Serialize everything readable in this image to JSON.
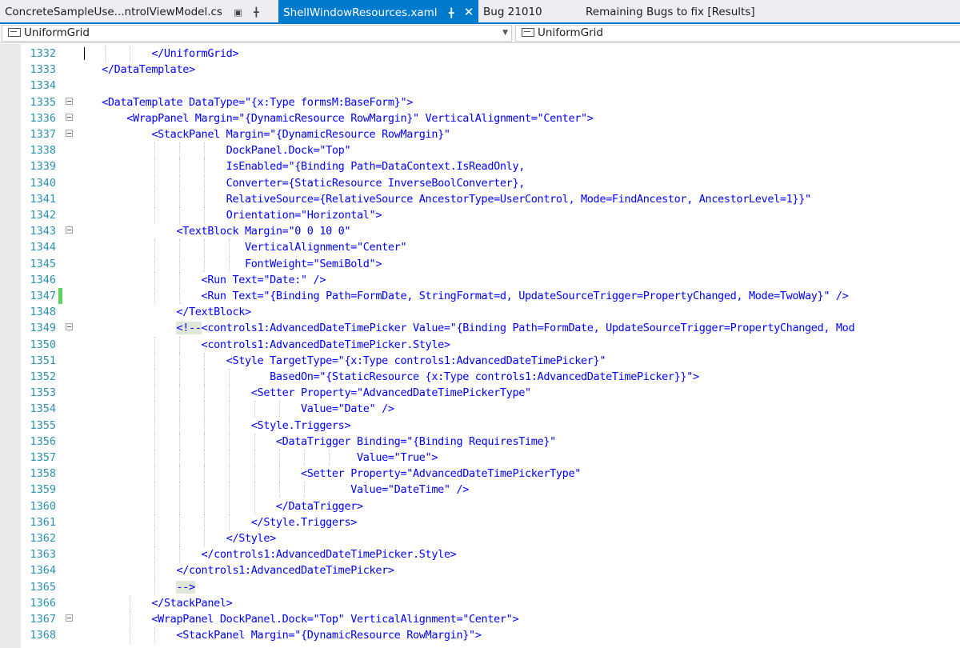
{
  "tabs": [
    {
      "label": "ConcreteSampleUse...ntrolViewModel.cs",
      "pin": "🖹",
      "pin_glyph": "⊞",
      "active": false
    },
    {
      "label": "ShellWindowResources.xaml",
      "active": true
    },
    {
      "label": "Bug 21010",
      "active": false
    },
    {
      "label": "Remaining Bugs to fix [Results]",
      "active": false
    }
  ],
  "navbar": {
    "left_value": "UniformGrid",
    "right_value": "UniformGrid"
  },
  "icons": {
    "lock": "lock-icon",
    "pin": "pin-icon",
    "close": "close-icon",
    "combo": "class-icon",
    "dropdown": "chevron-down-icon"
  },
  "colors": {
    "accent": "#007acc",
    "line_numbers": "#2b91af",
    "xml_markup": "#0000ff",
    "change_bar": "#5fd35f"
  },
  "editor": {
    "lines": [
      {
        "num": "1332",
        "text": "            </UniformGrid>"
      },
      {
        "num": "1333",
        "text": "    </DataTemplate>"
      },
      {
        "num": "1334",
        "text": ""
      },
      {
        "num": "1335",
        "text": "    <DataTemplate DataType=\"{x:Type formsM:BaseForm}\">"
      },
      {
        "num": "1336",
        "text": "        <WrapPanel Margin=\"{DynamicResource RowMargin}\" VerticalAlignment=\"Center\">"
      },
      {
        "num": "1337",
        "text": "            <StackPanel Margin=\"{DynamicResource RowMargin}\""
      },
      {
        "num": "1338",
        "text": "                        DockPanel.Dock=\"Top\""
      },
      {
        "num": "1339",
        "text": "                        IsEnabled=\"{Binding Path=DataContext.IsReadOnly,"
      },
      {
        "num": "1340",
        "text": "                        Converter={StaticResource InverseBoolConverter},"
      },
      {
        "num": "1341",
        "text": "                        RelativeSource={RelativeSource AncestorType=UserControl, Mode=FindAncestor, AncestorLevel=1}}\""
      },
      {
        "num": "1342",
        "text": "                        Orientation=\"Horizontal\">"
      },
      {
        "num": "1343",
        "text": "                <TextBlock Margin=\"0 0 10 0\""
      },
      {
        "num": "1344",
        "text": "                           VerticalAlignment=\"Center\""
      },
      {
        "num": "1345",
        "text": "                           FontWeight=\"SemiBold\">"
      },
      {
        "num": "1346",
        "text": "                    <Run Text=\"Date:\" />"
      },
      {
        "num": "1347",
        "text": "                    <Run Text=\"{Binding Path=FormDate, StringFormat=d, UpdateSourceTrigger=PropertyChanged, Mode=TwoWay}\" />"
      },
      {
        "num": "1348",
        "text": "                </TextBlock>"
      },
      {
        "num": "1349",
        "text": "                <!--<controls1:AdvancedDateTimePicker Value=\"{Binding Path=FormDate, UpdateSourceTrigger=PropertyChanged, Mod"
      },
      {
        "num": "1350",
        "text": "                    <controls1:AdvancedDateTimePicker.Style>"
      },
      {
        "num": "1351",
        "text": "                        <Style TargetType=\"{x:Type controls1:AdvancedDateTimePicker}\""
      },
      {
        "num": "1352",
        "text": "                               BasedOn=\"{StaticResource {x:Type controls1:AdvancedDateTimePicker}}\">"
      },
      {
        "num": "1353",
        "text": "                            <Setter Property=\"AdvancedDateTimePickerType\""
      },
      {
        "num": "1354",
        "text": "                                    Value=\"Date\" />"
      },
      {
        "num": "1355",
        "text": "                            <Style.Triggers>"
      },
      {
        "num": "1356",
        "text": "                                <DataTrigger Binding=\"{Binding RequiresTime}\""
      },
      {
        "num": "1357",
        "text": "                                             Value=\"True\">"
      },
      {
        "num": "1358",
        "text": "                                    <Setter Property=\"AdvancedDateTimePickerType\""
      },
      {
        "num": "1359",
        "text": "                                            Value=\"DateTime\" />"
      },
      {
        "num": "1360",
        "text": "                                </DataTrigger>"
      },
      {
        "num": "1361",
        "text": "                            </Style.Triggers>"
      },
      {
        "num": "1362",
        "text": "                        </Style>"
      },
      {
        "num": "1363",
        "text": "                    </controls1:AdvancedDateTimePicker.Style>"
      },
      {
        "num": "1364",
        "text": "                </controls1:AdvancedDateTimePicker>"
      },
      {
        "num": "1365",
        "text": "                -->"
      },
      {
        "num": "1366",
        "text": "            </StackPanel>"
      },
      {
        "num": "1367",
        "text": "            <WrapPanel DockPanel.Dock=\"Top\" VerticalAlignment=\"Center\">"
      },
      {
        "num": "1368",
        "text": "                <StackPanel Margin=\"{DynamicResource RowMargin}\">"
      }
    ]
  }
}
